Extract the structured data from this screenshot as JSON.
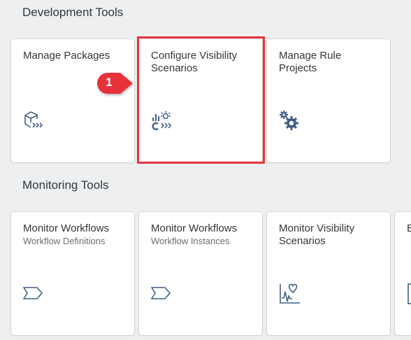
{
  "sections": {
    "development": {
      "title": "Development Tools"
    },
    "monitoring": {
      "title": "Monitoring Tools"
    }
  },
  "tiles": {
    "manage_packages": {
      "title": "Manage Packages",
      "icon": "package-icon"
    },
    "configure_visibility": {
      "title": "Configure Visibility Scenarios",
      "icon": "visibility-config-icon"
    },
    "manage_rule": {
      "title": "Manage Rule Projects",
      "icon": "gears-icon"
    },
    "monitor_wf_defs": {
      "title": "Monitor Workflows",
      "subtitle": "Workflow Definitions",
      "icon": "process-icon"
    },
    "monitor_wf_inst": {
      "title": "Monitor Workflows",
      "subtitle": "Workflow Instances",
      "icon": "process-icon"
    },
    "monitor_visibility": {
      "title": "Monitor Visibility Scenarios",
      "icon": "heart-pulse-icon"
    },
    "partial": {
      "title": "B",
      "icon": "document-icon"
    }
  },
  "callout": {
    "number": "1",
    "color": "#e8333b"
  },
  "colors": {
    "icon": "#3f5f84",
    "highlight": "#e8333b",
    "background": "#edeff0"
  }
}
